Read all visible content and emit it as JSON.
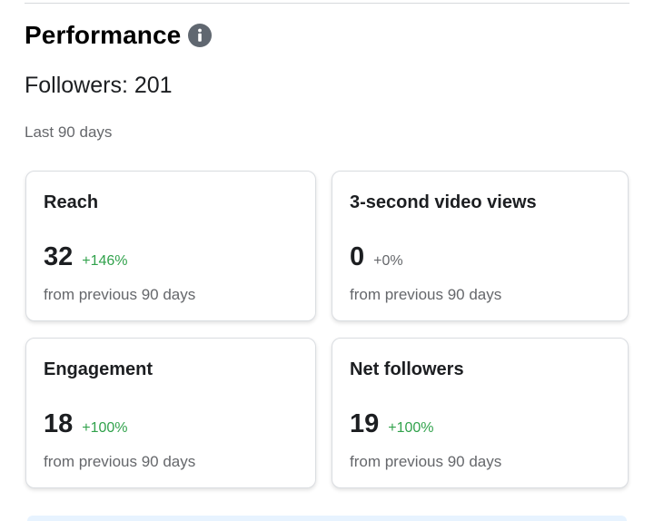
{
  "section": {
    "title": "Performance",
    "info_icon": "info-icon",
    "followers_text": "Followers: 201",
    "period": "Last 90 days"
  },
  "colors": {
    "positive": "#31a24c",
    "neutral": "#65676b",
    "info_icon": "#606770",
    "bottom_panel": "#e7f3ff"
  },
  "cards": [
    {
      "title": "Reach",
      "value": "32",
      "change": "+146%",
      "change_type": "positive",
      "sub": "from previous 90 days"
    },
    {
      "title": "3-second video views",
      "value": "0",
      "change": "+0%",
      "change_type": "neutral",
      "sub": "from previous 90 days"
    },
    {
      "title": "Engagement",
      "value": "18",
      "change": "+100%",
      "change_type": "positive",
      "sub": "from previous 90 days"
    },
    {
      "title": "Net followers",
      "value": "19",
      "change": "+100%",
      "change_type": "positive",
      "sub": "from previous 90 days"
    }
  ]
}
